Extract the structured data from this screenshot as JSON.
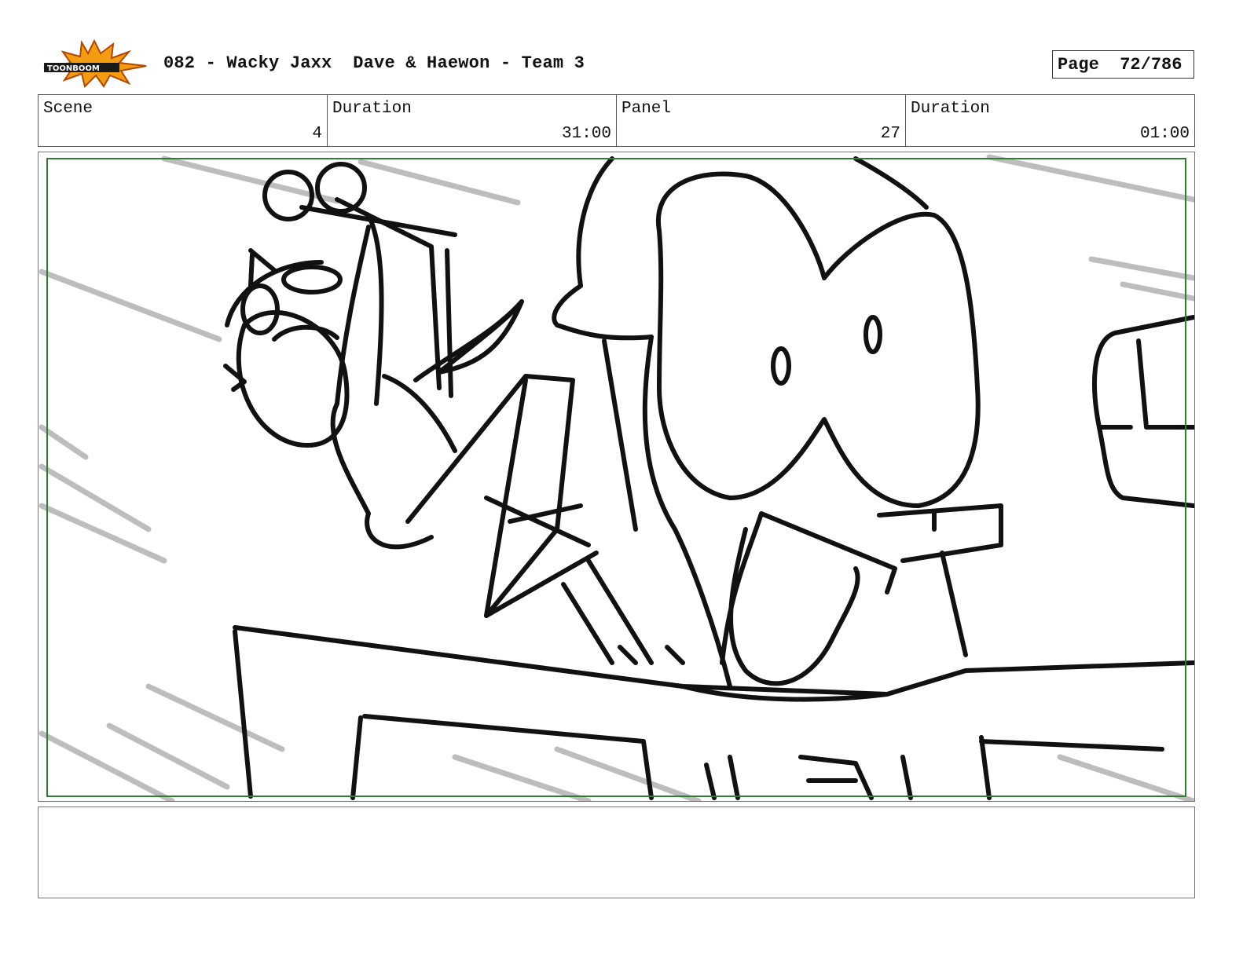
{
  "header": {
    "logo_text": "TOONBOOM",
    "title": "082 - Wacky Jaxx  Dave & Haewon - Team 3",
    "page_label": "Page",
    "page_value": "72/786"
  },
  "info": {
    "scene_label": "Scene",
    "scene_value": "4",
    "scene_duration_label": "Duration",
    "scene_duration_value": "31:00",
    "panel_label": "Panel",
    "panel_value": "27",
    "panel_duration_label": "Duration",
    "panel_duration_value": "01:00"
  },
  "notes": {
    "text": ""
  },
  "colors": {
    "safe_frame": "#2e7d32",
    "logo_burst": "#f39c12",
    "sketch_line": "#111111",
    "speed_line": "#bdbdbd"
  }
}
